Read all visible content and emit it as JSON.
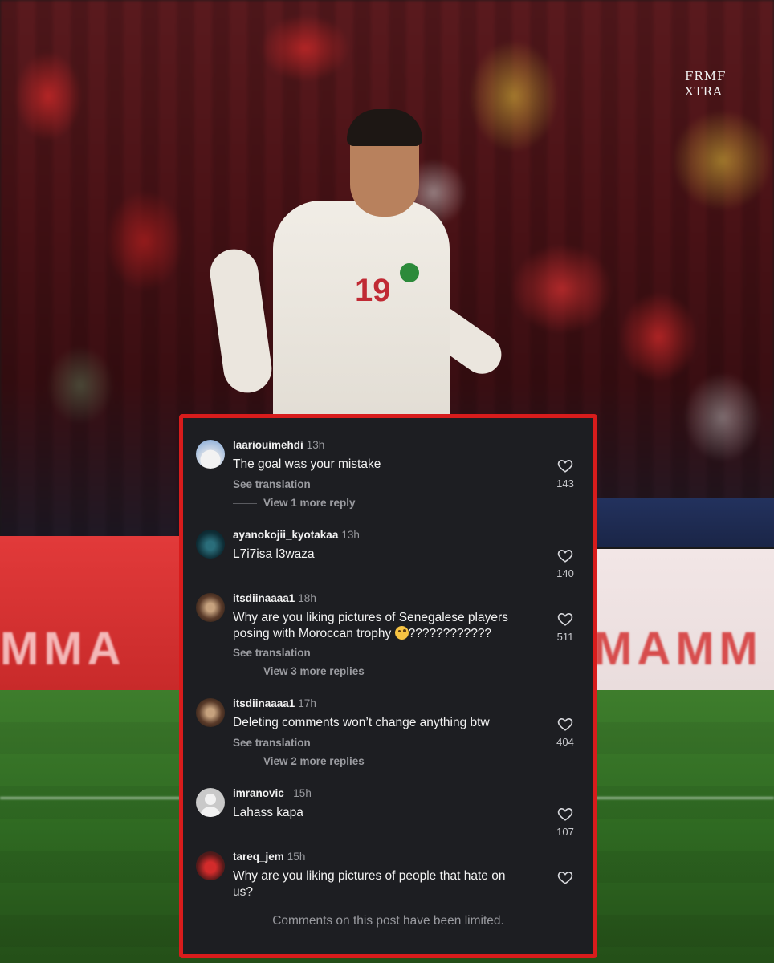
{
  "watermark": {
    "line1": "FRMF",
    "line2": "XTRA"
  },
  "background": {
    "player_number": "19",
    "board_left_text": "MMA",
    "board_right_text": "MAMM"
  },
  "comments": [
    {
      "username": "laariouimehdi",
      "time": "13h",
      "text": "The goal was your mistake",
      "see_translation": "See translation",
      "more_replies": "View 1 more reply",
      "likes": "143"
    },
    {
      "username": "ayanokojii_kyotakaa",
      "time": "13h",
      "text": "L7i7isa l3waza",
      "likes": "140"
    },
    {
      "username": "itsdiinaaaa1",
      "time": "18h",
      "text_line1": "Why are you liking pictures of Senegalese players",
      "text_line2": "posing with Moroccan trophy",
      "text_line2_suffix": "????????????",
      "see_translation": "See translation",
      "more_replies": "View 3 more replies",
      "likes": "511"
    },
    {
      "username": "itsdiinaaaa1",
      "time": "17h",
      "text": "Deleting comments won’t change anything btw",
      "see_translation": "See translation",
      "more_replies": "View 2 more replies",
      "likes": "404"
    },
    {
      "username": "imranovic_",
      "time": "15h",
      "text": "Lahass kapa",
      "likes": "107"
    },
    {
      "username": "tareq_jem",
      "time": "15h",
      "text_line1": "Why are you liking pictures of people that hate on",
      "text_line2": "us?"
    }
  ],
  "footer": {
    "limited_notice": "Comments on this post have been limited."
  },
  "icons": {
    "like": "heart-outline-icon",
    "emoji": "monocle-face-emoji-icon",
    "default_avatar": "default-user-avatar-icon"
  },
  "colors": {
    "panel_bg": "#1d1e22",
    "panel_border": "#d81c1c",
    "text_primary": "#f2f2f2",
    "text_secondary": "#9a9ba0"
  }
}
